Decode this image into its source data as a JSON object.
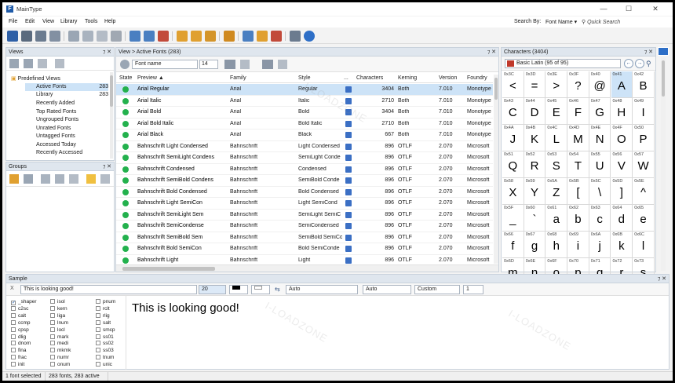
{
  "app": {
    "title": "MainType",
    "icon_letter": "F"
  },
  "window_controls": {
    "minimize": "—",
    "maximize": "☐",
    "close": "✕"
  },
  "menubar": {
    "items": [
      "File",
      "Edit",
      "View",
      "Library",
      "Tools",
      "Help"
    ],
    "search_by_label": "Search By:",
    "search_by_value": "Font Name ▾",
    "quick_search_placeholder": "Quick Search"
  },
  "views_panel": {
    "title": "Views",
    "pins": "⁊ ✕",
    "tree": [
      {
        "label": "Predefined Views",
        "count": ""
      },
      {
        "label": "Active Fonts",
        "count": "283"
      },
      {
        "label": "Library",
        "count": "283"
      },
      {
        "label": "Recently Added",
        "count": ""
      },
      {
        "label": "Top Rated Fonts",
        "count": ""
      },
      {
        "label": "Ungrouped Fonts",
        "count": ""
      },
      {
        "label": "Unrated Fonts",
        "count": ""
      },
      {
        "label": "Untagged Fonts",
        "count": ""
      },
      {
        "label": "Accessed Today",
        "count": ""
      },
      {
        "label": "Recently Accessed",
        "count": ""
      }
    ]
  },
  "groups_panel": {
    "title": "Groups",
    "pins": "⁊ ✕"
  },
  "list_panel": {
    "title": "View > Active Fonts (283)",
    "pins": "⁊ ✕",
    "font_name_select": "Font name",
    "font_size": "14",
    "columns": [
      "State",
      "Preview ▲",
      "Family",
      "Style",
      "...",
      "Characters",
      "Kerning",
      "Version",
      "Foundry"
    ],
    "rows": [
      {
        "preview": "Arial Regular",
        "family": "Arial",
        "style": "Regular",
        "chars": "3404",
        "kerning": "Both",
        "version": "7.010",
        "foundry": "Monotype"
      },
      {
        "preview": "Arial Italic",
        "family": "Arial",
        "style": "Italic",
        "chars": "2710",
        "kerning": "Both",
        "version": "7.010",
        "foundry": "Monotype"
      },
      {
        "preview": "Arial Bold",
        "family": "Arial",
        "style": "Bold",
        "chars": "3404",
        "kerning": "Both",
        "version": "7.010",
        "foundry": "Monotype"
      },
      {
        "preview": "Arial Bold Italic",
        "family": "Arial",
        "style": "Bold Italic",
        "chars": "2710",
        "kerning": "Both",
        "version": "7.010",
        "foundry": "Monotype"
      },
      {
        "preview": "Arial Black",
        "family": "Arial",
        "style": "Black",
        "chars": "667",
        "kerning": "Both",
        "version": "7.010",
        "foundry": "Monotype"
      },
      {
        "preview": "Bahnschrift Light Condensed",
        "family": "Bahnschrift",
        "style": "Light Condensed",
        "chars": "896",
        "kerning": "OTLF",
        "version": "2.070",
        "foundry": "Microsoft"
      },
      {
        "preview": "Bahnschrift SemiLight Condens",
        "family": "Bahnschrift",
        "style": "SemiLight Conde",
        "chars": "896",
        "kerning": "OTLF",
        "version": "2.070",
        "foundry": "Microsoft"
      },
      {
        "preview": "Bahnschrift Condensed",
        "family": "Bahnschrift",
        "style": "Condensed",
        "chars": "896",
        "kerning": "OTLF",
        "version": "2.070",
        "foundry": "Microsoft"
      },
      {
        "preview": "Bahnschrift SemiBold Condens",
        "family": "Bahnschrift",
        "style": "SemiBold Conde",
        "chars": "896",
        "kerning": "OTLF",
        "version": "2.070",
        "foundry": "Microsoft"
      },
      {
        "preview": "Bahnschrift Bold Condensed",
        "family": "Bahnschrift",
        "style": "Bold Condensed",
        "chars": "896",
        "kerning": "OTLF",
        "version": "2.070",
        "foundry": "Microsoft"
      },
      {
        "preview": "Bahnschrift Light SemiCon",
        "family": "Bahnschrift",
        "style": "Light SemiCond",
        "chars": "896",
        "kerning": "OTLF",
        "version": "2.070",
        "foundry": "Microsoft"
      },
      {
        "preview": "Bahnschrift SemiLight Sem",
        "family": "Bahnschrift",
        "style": "SemiLight SemiC",
        "chars": "896",
        "kerning": "OTLF",
        "version": "2.070",
        "foundry": "Microsoft"
      },
      {
        "preview": "Bahnschrift SemiCondense",
        "family": "Bahnschrift",
        "style": "SemiCondensed",
        "chars": "896",
        "kerning": "OTLF",
        "version": "2.070",
        "foundry": "Microsoft"
      },
      {
        "preview": "Bahnschrift SemiBold Sem",
        "family": "Bahnschrift",
        "style": "SemiBold SemiCo",
        "chars": "896",
        "kerning": "OTLF",
        "version": "2.070",
        "foundry": "Microsoft"
      },
      {
        "preview": "Bahnschrift Bold SemiCon",
        "family": "Bahnschrift",
        "style": "Bold SemiConde",
        "chars": "896",
        "kerning": "OTLF",
        "version": "2.070",
        "foundry": "Microsoft"
      },
      {
        "preview": "Bahnschrift Light",
        "family": "Bahnschrift",
        "style": "Light",
        "chars": "896",
        "kerning": "OTLF",
        "version": "2.070",
        "foundry": "Microsoft"
      }
    ]
  },
  "chars_panel": {
    "title": "Characters (3404)",
    "pins": "⁊ ✕",
    "range": "Basic Latin (95 of 95)",
    "nav_back": "←",
    "nav_forward": "→",
    "cells": [
      {
        "code": "0x3C",
        "glyph": "<"
      },
      {
        "code": "0x3D",
        "glyph": "="
      },
      {
        "code": "0x3E",
        "glyph": ">"
      },
      {
        "code": "0x3F",
        "glyph": "?"
      },
      {
        "code": "0x40",
        "glyph": "@"
      },
      {
        "code": "0x41",
        "glyph": "A"
      },
      {
        "code": "0x42",
        "glyph": "B"
      },
      {
        "code": "0x43",
        "glyph": "C"
      },
      {
        "code": "0x44",
        "glyph": "D"
      },
      {
        "code": "0x45",
        "glyph": "E"
      },
      {
        "code": "0x46",
        "glyph": "F"
      },
      {
        "code": "0x47",
        "glyph": "G"
      },
      {
        "code": "0x48",
        "glyph": "H"
      },
      {
        "code": "0x49",
        "glyph": "I"
      },
      {
        "code": "0x4A",
        "glyph": "J"
      },
      {
        "code": "0x4B",
        "glyph": "K"
      },
      {
        "code": "0x4C",
        "glyph": "L"
      },
      {
        "code": "0x4D",
        "glyph": "M"
      },
      {
        "code": "0x4E",
        "glyph": "N"
      },
      {
        "code": "0x4F",
        "glyph": "O"
      },
      {
        "code": "0x50",
        "glyph": "P"
      },
      {
        "code": "0x51",
        "glyph": "Q"
      },
      {
        "code": "0x52",
        "glyph": "R"
      },
      {
        "code": "0x53",
        "glyph": "S"
      },
      {
        "code": "0x54",
        "glyph": "T"
      },
      {
        "code": "0x55",
        "glyph": "U"
      },
      {
        "code": "0x56",
        "glyph": "V"
      },
      {
        "code": "0x57",
        "glyph": "W"
      },
      {
        "code": "0x58",
        "glyph": "X"
      },
      {
        "code": "0x59",
        "glyph": "Y"
      },
      {
        "code": "0x5A",
        "glyph": "Z"
      },
      {
        "code": "0x5B",
        "glyph": "["
      },
      {
        "code": "0x5C",
        "glyph": "\\"
      },
      {
        "code": "0x5D",
        "glyph": "]"
      },
      {
        "code": "0x5E",
        "glyph": "^"
      },
      {
        "code": "0x5F",
        "glyph": "_"
      },
      {
        "code": "0x60",
        "glyph": "`"
      },
      {
        "code": "0x61",
        "glyph": "a"
      },
      {
        "code": "0x62",
        "glyph": "b"
      },
      {
        "code": "0x63",
        "glyph": "c"
      },
      {
        "code": "0x64",
        "glyph": "d"
      },
      {
        "code": "0x65",
        "glyph": "e"
      },
      {
        "code": "0x66",
        "glyph": "f"
      },
      {
        "code": "0x67",
        "glyph": "g"
      },
      {
        "code": "0x68",
        "glyph": "h"
      },
      {
        "code": "0x69",
        "glyph": "i"
      },
      {
        "code": "0x6A",
        "glyph": "j"
      },
      {
        "code": "0x6B",
        "glyph": "k"
      },
      {
        "code": "0x6C",
        "glyph": "l"
      },
      {
        "code": "0x6D",
        "glyph": "m"
      },
      {
        "code": "0x6E",
        "glyph": "n"
      },
      {
        "code": "0x6F",
        "glyph": "o"
      },
      {
        "code": "0x70",
        "glyph": "p"
      },
      {
        "code": "0x71",
        "glyph": "q"
      },
      {
        "code": "0x72",
        "glyph": "r"
      },
      {
        "code": "0x73",
        "glyph": "s"
      }
    ],
    "selected_code": "0x41"
  },
  "sample_panel": {
    "title": "Sample",
    "pins": "⁊ ✕",
    "text_value": "This is looking good!",
    "size_value": "20",
    "auto_1": "Auto",
    "auto_2": "Auto",
    "custom": "Custom",
    "spin_value": "1",
    "feature_columns": [
      [
        "_shaper",
        "c2sc",
        "calt",
        "ccmp",
        "cpsp",
        "dlig",
        "dnom",
        "fina",
        "frac",
        "init"
      ],
      [
        "isol",
        "kern",
        "liga",
        "lnum",
        "locl",
        "mark",
        "medi",
        "mkmk",
        "numr",
        "onum"
      ],
      [
        "pnum",
        "rclt",
        "rlig",
        "salt",
        "smcp",
        "ss01",
        "ss02",
        "ss03",
        "tnum",
        "unic"
      ]
    ],
    "checked_feature": "_shaper",
    "check_glyph": "✓",
    "preview_text": "This is looking good!"
  },
  "status": {
    "selected": "1 font selected",
    "summary": "283 fonts, 283 active"
  },
  "watermark": "I-LOADZONE",
  "colors": {
    "active_dot": "#23b14d",
    "selection": "#cde3f7",
    "panel_header": "#dfe6ee",
    "accent": "#1e5aa8"
  }
}
